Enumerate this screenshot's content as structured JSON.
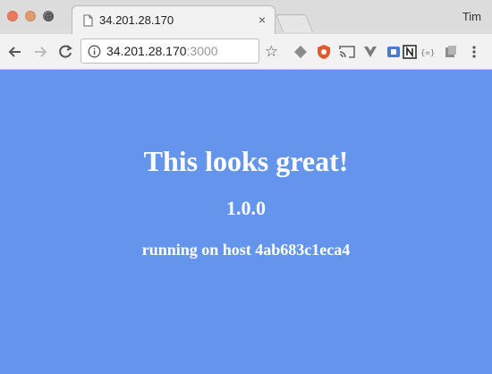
{
  "window": {
    "profile_name": "Tim"
  },
  "tab": {
    "title": "34.201.28.170",
    "close_glyph": "×"
  },
  "toolbar": {
    "url_host": "34.201.28.170",
    "url_port": ":3000",
    "star_glyph": "☆",
    "extensions": [
      "ext-icon-1",
      "ublock-icon",
      "cast-icon",
      "vue-devtools-icon",
      "ext-icon-5",
      "notion-icon",
      "json-viewer-icon",
      "ext-icon-8",
      "menu-icon"
    ]
  },
  "page": {
    "heading": "This looks great!",
    "version": "1.0.0",
    "host_line": "running on host 4ab683c1eca4",
    "background_color": "#6495ed"
  }
}
